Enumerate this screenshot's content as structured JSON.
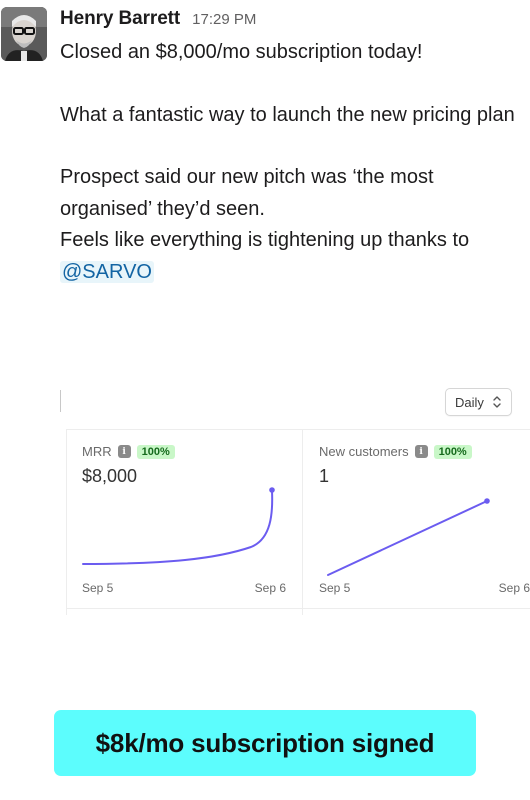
{
  "message": {
    "author": "Henry Barrett",
    "time": "17:29 PM",
    "paragraphs": [
      "Closed an $8,000/mo subscription today!",
      "What a fantastic way to launch the new pricing plan",
      "Prospect said our new pitch was ‘the most organised’ they’d seen.\nFeels like everything is tightening up thanks to "
    ],
    "mention": "@SARVO"
  },
  "card": {
    "period_select": "Daily",
    "panels": [
      {
        "title": "MRR",
        "badge": "100%",
        "value": "$8,000",
        "x_start": "Sep 5",
        "x_end": "Sep 6"
      },
      {
        "title": "New customers",
        "badge": "100%",
        "value": "1",
        "x_start": "Sep 5",
        "x_end": "Sep 6"
      }
    ],
    "line_color": "#6b5cf0"
  },
  "banner": {
    "text": "$8k/mo subscription signed",
    "color": "#5cfdfd"
  }
}
